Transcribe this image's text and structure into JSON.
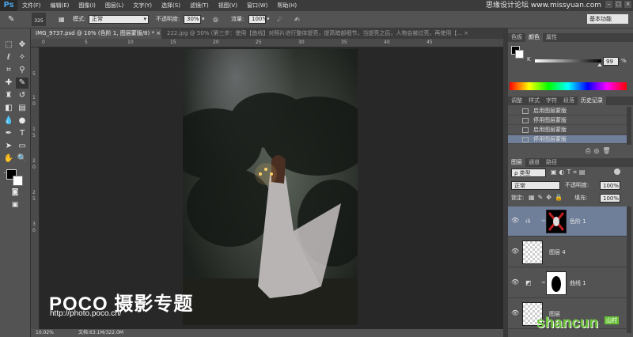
{
  "app": {
    "logo": "Ps",
    "workspace": "基本功能"
  },
  "menu": [
    "文件(F)",
    "编辑(E)",
    "图像(I)",
    "图层(L)",
    "文字(Y)",
    "选择(S)",
    "滤镜(T)",
    "视图(V)",
    "窗口(W)",
    "帮助(H)"
  ],
  "options": {
    "brush_size": "325",
    "mode_label": "模式:",
    "mode_value": "正常",
    "opacity_label": "不透明度:",
    "opacity_value": "30%",
    "flow_label": "流量:",
    "flow_value": "100%"
  },
  "tabs": [
    {
      "label": "IMG_9737.psd @ 10% (色阶 1, 图层蒙版/8) *",
      "close": "×"
    },
    {
      "label": "222.jpg @ 50% (第三步：使用【曲线】对照片进行整体提亮，提高暗部细节，当提亮之后，人物会被过亮，再使用【...",
      "close": "×"
    }
  ],
  "ruler_top": [
    "0",
    "5",
    "10",
    "15",
    "20",
    "25",
    "30",
    "35",
    "40",
    "45"
  ],
  "ruler_left": [
    "5",
    "1",
    "0",
    "1",
    "5",
    "2",
    "0",
    "2",
    "5",
    "3",
    "0"
  ],
  "status": {
    "zoom": "10.02%",
    "doc": "文档:63.1M/322.0M"
  },
  "color_panel": {
    "tabs": [
      "色板",
      "颜色",
      "属性"
    ],
    "active_tab": "颜色",
    "channel": "K",
    "value": "99",
    "unit": "%"
  },
  "history_panel": {
    "tabs": [
      "调整",
      "样式",
      "字符",
      "段落",
      "历史记录"
    ],
    "active_tab": "历史记录",
    "items": [
      "启用图层蒙版",
      "停用图层蒙版",
      "启用图层蒙版",
      "停用图层蒙版"
    ],
    "current_index": 3
  },
  "layers_panel": {
    "tabs": [
      "图层",
      "通道",
      "路径"
    ],
    "active_tab": "图层",
    "filter_kind": "类型",
    "blend_mode": "正常",
    "opacity_label": "不透明度:",
    "opacity": "100%",
    "lock_label": "锁定:",
    "fill_label": "填充:",
    "fill": "100%",
    "layers": [
      {
        "name": "色阶 1",
        "selected": true
      },
      {
        "name": "图层 4",
        "selected": false
      },
      {
        "name": "曲线 1",
        "selected": false
      },
      {
        "name": "图层",
        "selected": false
      }
    ]
  },
  "watermarks": {
    "top": "思缘设计论坛 www.missyuan.com",
    "poco": "POCO 摄影专题",
    "poco_url": "http://photo.poco.cn/",
    "shancun": "shancun",
    "shancun_sub": "山村"
  }
}
